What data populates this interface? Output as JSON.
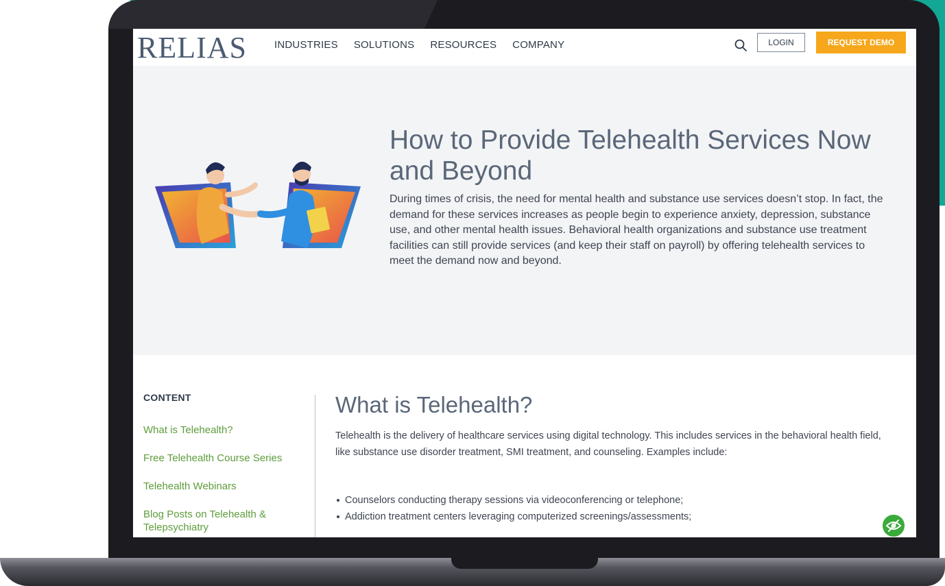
{
  "brand": {
    "logo_text": "RELIAS"
  },
  "nav": {
    "items": [
      "INDUSTRIES",
      "SOLUTIONS",
      "RESOURCES",
      "COMPANY"
    ]
  },
  "header": {
    "login_label": "LOGIN",
    "demo_label": "REQUEST DEMO"
  },
  "hero": {
    "title": "How to Provide Telehealth Services Now and Beyond",
    "text": "During times of crisis, the need for mental health and substance use services doesn’t stop. In fact, the demand for these services increases as people begin to experience anxiety, depression, substance use, and other mental health issues. Behavioral health organizations and substance use treatment facilities can still provide services (and keep their staff on payroll) by offering telehealth services to meet the demand now and beyond."
  },
  "sidebar": {
    "heading": "CONTENT",
    "links": [
      "What is Telehealth?",
      "Free Telehealth Course Series",
      "Telehealth Webinars",
      "Blog Posts on Telehealth & Telepsychiatry"
    ]
  },
  "section": {
    "title": "What is Telehealth?",
    "text": "Telehealth is the delivery of healthcare services using digital technology. This includes services in the behavioral health field, like substance use disorder treatment, SMI treatment, and counseling. Examples include:",
    "bullets": [
      "Counselors conducting therapy sessions via videoconferencing or telephone;",
      "Addiction treatment centers leveraging computerized screenings/assessments;"
    ]
  },
  "colors": {
    "accent_teal": "#13a896",
    "demo_orange": "#f6a71b",
    "link_green": "#5e9c3c",
    "a11y_green": "#3aaa3a"
  }
}
